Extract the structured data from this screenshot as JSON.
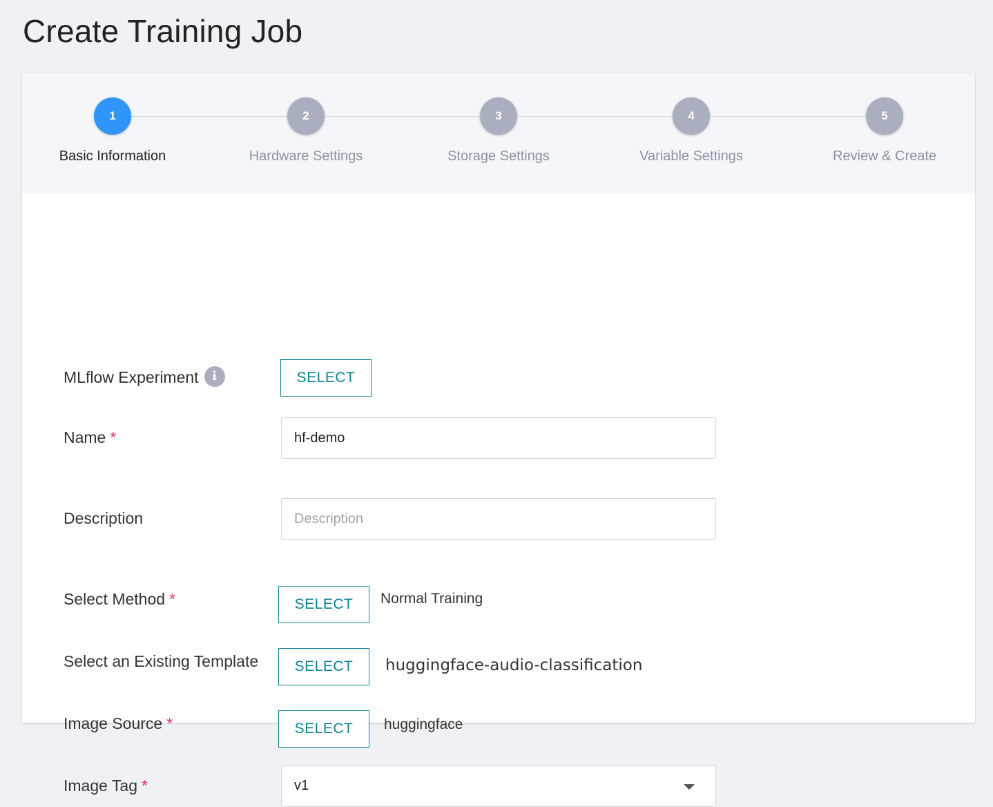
{
  "page": {
    "title": "Create Training Job"
  },
  "stepper": {
    "steps": [
      {
        "number": "1",
        "label": "Basic Information",
        "active": true
      },
      {
        "number": "2",
        "label": "Hardware Settings",
        "active": false
      },
      {
        "number": "3",
        "label": "Storage Settings",
        "active": false
      },
      {
        "number": "4",
        "label": "Variable Settings",
        "active": false
      },
      {
        "number": "5",
        "label": "Review & Create",
        "active": false
      }
    ]
  },
  "form": {
    "mlflow": {
      "label": "MLflow Experiment",
      "info_icon": "i",
      "button": "SELECT"
    },
    "name": {
      "label": "Name",
      "required_mark": "*",
      "value": "hf-demo"
    },
    "description": {
      "label": "Description",
      "placeholder": "Description",
      "value": ""
    },
    "method": {
      "label": "Select Method",
      "required_mark": "*",
      "button": "SELECT",
      "value": "Normal Training"
    },
    "template": {
      "label": "Select an Existing Template",
      "button": "SELECT",
      "value": "huggingface-audio-classification"
    },
    "image_source": {
      "label": "Image Source",
      "required_mark": "*",
      "button": "SELECT",
      "value": "huggingface"
    },
    "image_tag": {
      "label": "Image Tag",
      "required_mark": "*",
      "value": "v1"
    }
  },
  "colors": {
    "accent": "#0d8194",
    "active_step": "#2f95f8",
    "inactive_step": "#a9afbf",
    "required": "#e0317a"
  }
}
